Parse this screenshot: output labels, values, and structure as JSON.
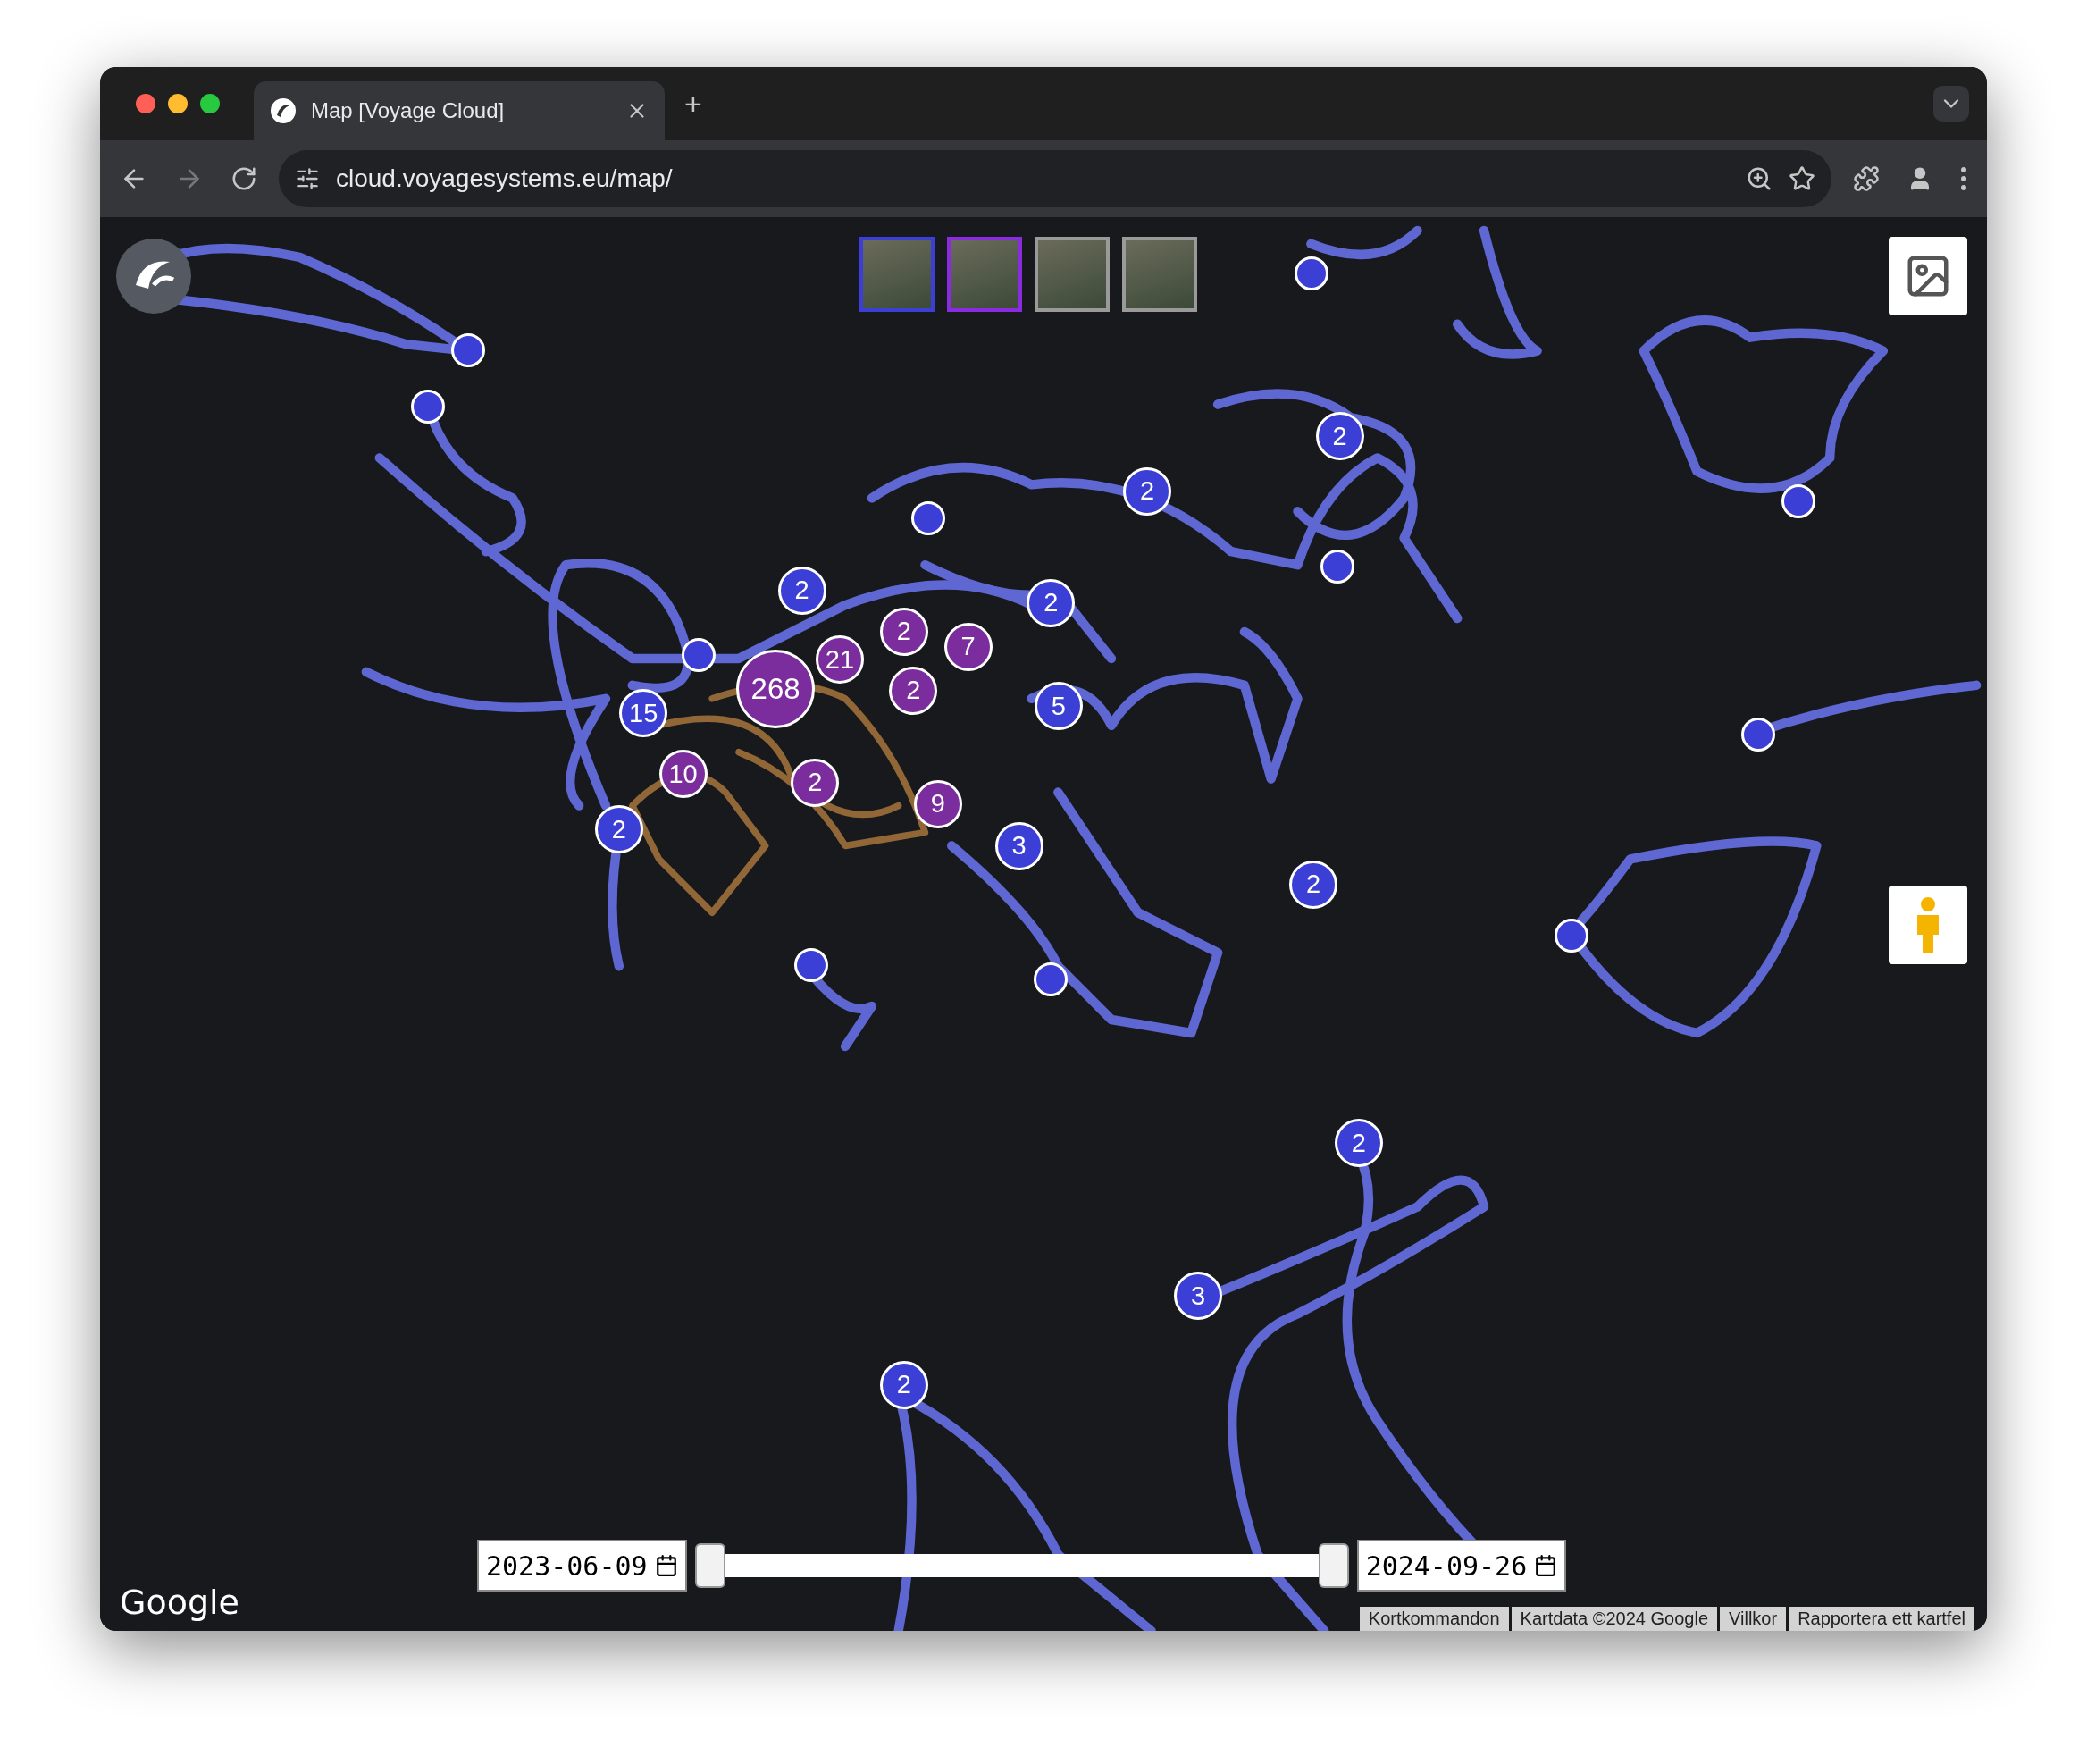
{
  "browser": {
    "tab": {
      "title": "Map [Voyage Cloud]",
      "selected": true
    },
    "new_tab": "+",
    "url": "cloud.voyagesystems.eu/map/"
  },
  "map": {
    "photos": [
      {
        "color": "#3b3fd6"
      },
      {
        "color": "#8a2be2"
      },
      {
        "color": "#9a9a9a"
      },
      {
        "color": "#9a9a9a"
      }
    ],
    "markers": [
      {
        "kind": "cluster",
        "count": "2",
        "color": "#3b3fd6"
      },
      {
        "kind": "cluster",
        "count": "2",
        "color": "#7b2d9e"
      },
      {
        "kind": "cluster",
        "count": "21",
        "color": "#7b2d9e"
      },
      {
        "kind": "cluster",
        "count": "7",
        "color": "#7b2d9e"
      },
      {
        "kind": "big",
        "count": "268",
        "color": "#7b2d9e"
      },
      {
        "kind": "cluster",
        "count": "2",
        "color": "#7b2d9e"
      },
      {
        "kind": "cluster",
        "count": "15",
        "color": "#3b3fd6"
      },
      {
        "kind": "cluster",
        "count": "10",
        "color": "#7b2d9e"
      },
      {
        "kind": "cluster",
        "count": "2",
        "color": "#7b2d9e"
      },
      {
        "kind": "cluster",
        "count": "9",
        "color": "#7b2d9e"
      },
      {
        "kind": "cluster",
        "count": "2",
        "color": "#3b3fd6"
      },
      {
        "kind": "cluster",
        "count": "3",
        "color": "#3b3fd6"
      },
      {
        "kind": "cluster",
        "count": "5",
        "color": "#3b3fd6"
      },
      {
        "kind": "cluster",
        "count": "2",
        "color": "#3b3fd6"
      },
      {
        "kind": "cluster",
        "count": "2",
        "color": "#3b3fd6"
      },
      {
        "kind": "cluster",
        "count": "2",
        "color": "#3b3fd6"
      },
      {
        "kind": "cluster",
        "count": "2",
        "color": "#3b3fd6"
      },
      {
        "kind": "cluster",
        "count": "2",
        "color": "#3b3fd6"
      },
      {
        "kind": "cluster",
        "count": "3",
        "color": "#3b3fd6"
      },
      {
        "kind": "cluster",
        "count": "2",
        "color": "#3b3fd6"
      },
      {
        "kind": "point",
        "color": "#3b3fd6"
      },
      {
        "kind": "point",
        "color": "#3b3fd6"
      },
      {
        "kind": "point",
        "color": "#3b3fd6"
      },
      {
        "kind": "point",
        "color": "#3b3fd6"
      },
      {
        "kind": "point",
        "color": "#3b3fd6"
      },
      {
        "kind": "point",
        "color": "#3b3fd6"
      },
      {
        "kind": "point",
        "color": "#3b3fd6"
      },
      {
        "kind": "point",
        "color": "#3b3fd6"
      },
      {
        "kind": "point",
        "color": "#3b3fd6"
      },
      {
        "kind": "point",
        "color": "#3b3fd6"
      },
      {
        "kind": "point",
        "color": "#3b3fd6"
      }
    ],
    "logo": "Google",
    "date_from": "2023-06-09",
    "date_to": "2024-09-26",
    "range": [
      {
        "level": 0
      },
      {
        "level": 1
      }
    ],
    "attribution": [
      "Kortkommandon",
      "Kartdata ©2024 Google",
      "Villkor",
      "Rapportera ett kartfel"
    ]
  }
}
